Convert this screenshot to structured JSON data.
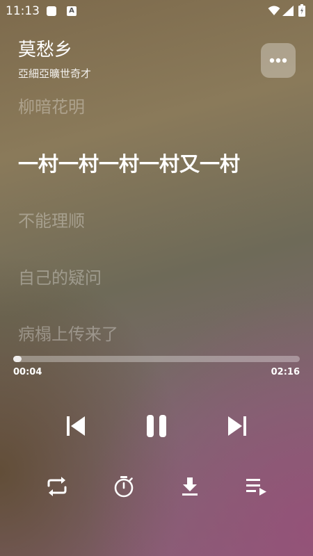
{
  "status_bar": {
    "time": "11:13",
    "icons": [
      "notification-square-icon",
      "a-badge-icon",
      "wifi-icon",
      "signal-icon",
      "battery-icon"
    ],
    "a_badge": "A"
  },
  "track": {
    "title": "莫愁乡",
    "artist": "亞細亞曠世奇才"
  },
  "lyrics": [
    "柳暗花明",
    "一村一村一村一村又一村",
    "不能理顺",
    "自己的疑问",
    "病榻上传来了"
  ],
  "active_lyric_index": 1,
  "progress": {
    "current": "00:04",
    "total": "02:16",
    "fraction": 0.03
  },
  "controls": {
    "transport": [
      "previous-icon",
      "pause-icon",
      "next-icon"
    ],
    "secondary": [
      "repeat-icon",
      "timer-icon",
      "download-icon",
      "playlist-icon"
    ]
  },
  "colors": {
    "text": "#ffffff",
    "dim_text": "rgba(255,255,255,0.32)"
  }
}
